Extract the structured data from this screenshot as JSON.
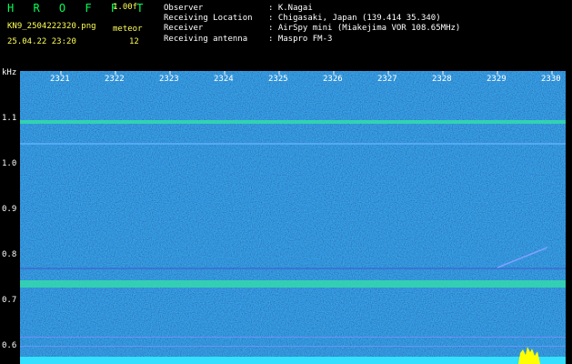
{
  "header": {
    "logo": "H R O F F T",
    "version": "1.00f",
    "filename": "KN9_2504222320.png",
    "meteor_label": "meteor",
    "datetime": "25.04.22 23:20",
    "meteor_count": "12",
    "observer_label": "Observer",
    "observer_value": ": K.Nagai",
    "location_label": "Receiving Location",
    "location_value": ": Chigasaki, Japan (139.414 35.340)",
    "receiver_label": "Receiver",
    "receiver_value": ": AirSpy mini (Miakejima VOR 108.65MHz)",
    "antenna_label": "Receiving antenna",
    "antenna_value": ": Maspro FM-3"
  },
  "axis": {
    "y_unit": "kHz",
    "y_ticks": [
      "1.1",
      "1.0",
      "0.9",
      "0.8",
      "0.7",
      "0.6"
    ],
    "x_ticks": [
      "2321",
      "2322",
      "2323",
      "2324",
      "2325",
      "2326",
      "2327",
      "2328",
      "2329",
      "2330"
    ]
  },
  "colors": {
    "background_noise": "#1a2a8a",
    "signal_band": "#33ddaa",
    "bottom_bar": "#33e0ff",
    "meteor_burst": "#ffff00"
  }
}
